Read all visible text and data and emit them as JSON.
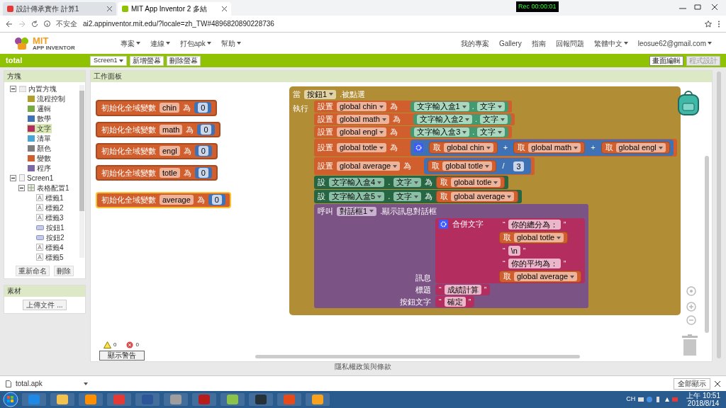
{
  "browser": {
    "tabs": [
      {
        "title": "設計傳承實作 計算1",
        "selected": false
      },
      {
        "title": "MIT App Inventor 2 多結",
        "selected": true
      }
    ],
    "recorder": "Rec 00:00:01",
    "address": {
      "security": "不安全",
      "url": "ai2.appinventor.mit.edu/?locale=zh_TW#4896820890228736"
    }
  },
  "header": {
    "logo_title": "MIT",
    "logo_subtitle": "APP INVENTOR",
    "menus": [
      "專案",
      "連線",
      "打包apk",
      "幫助"
    ],
    "links": [
      "我的專案",
      "Gallery",
      "指南",
      "回報問題"
    ],
    "language": "繁體中文",
    "account": "leosue62@gmail.com"
  },
  "toolbar": {
    "project": "total",
    "screen": "Screen1",
    "buttons": [
      "新增螢幕",
      "刪除螢幕"
    ],
    "modes": [
      {
        "label": "畫面編輯",
        "selected": false
      },
      {
        "label": "程式設計",
        "selected": true
      }
    ]
  },
  "palette": {
    "title": "方塊",
    "tree": [
      {
        "label": "內置方塊",
        "kind": "folder",
        "expanded": true,
        "children": [
          {
            "label": "流程控制",
            "color": "#b1a02c",
            "selected": false
          },
          {
            "label": "邏輯",
            "color": "#77ab41",
            "selected": false
          },
          {
            "label": "數學",
            "color": "#3f71b5",
            "selected": false
          },
          {
            "label": "文字",
            "color": "#b32d5e",
            "selected": true
          },
          {
            "label": "清單",
            "color": "#49a6d4",
            "selected": false
          },
          {
            "label": "顏色",
            "color": "#7d7d7d",
            "selected": false
          },
          {
            "label": "變數",
            "color": "#d05f2d",
            "selected": false
          },
          {
            "label": "程序",
            "color": "#7c68a6",
            "selected": false
          }
        ]
      },
      {
        "label": "Screen1",
        "kind": "screen",
        "expanded": true,
        "children": [
          {
            "label": "表格配置1",
            "kind": "arrangement",
            "expanded": true,
            "children": [
              {
                "label": "標籤1",
                "kind": "label"
              },
              {
                "label": "標籤2",
                "kind": "label"
              },
              {
                "label": "標籤3",
                "kind": "label"
              },
              {
                "label": "按鈕1",
                "kind": "button"
              },
              {
                "label": "按鈕2",
                "kind": "button"
              },
              {
                "label": "標籤4",
                "kind": "label"
              },
              {
                "label": "標籤5",
                "kind": "label"
              }
            ]
          }
        ]
      }
    ],
    "buttons": [
      "重新命名",
      "刪除"
    ]
  },
  "media": {
    "title": "素材",
    "upload": "上傳文件 ..."
  },
  "workspace": {
    "title": "工作面板",
    "globals": [
      {
        "label": "初始化全域變數",
        "name": "chin",
        "to": "為",
        "value": "0",
        "selected": false
      },
      {
        "label": "初始化全域變數",
        "name": "math",
        "to": "為",
        "value": "0",
        "selected": false
      },
      {
        "label": "初始化全域變數",
        "name": "engl",
        "to": "為",
        "value": "0",
        "selected": false
      },
      {
        "label": "初始化全域變數",
        "name": "totle",
        "to": "為",
        "value": "0",
        "selected": false
      },
      {
        "label": "初始化全域變數",
        "name": "average",
        "to": "為",
        "value": "0",
        "selected": true
      }
    ],
    "event": {
      "keyword": "當",
      "component": "按鈕1",
      "event": ".被點選",
      "do_label": "執行",
      "statements": [
        {
          "kind": "set_var",
          "keyword": "設置",
          "var": "global chin",
          "to": "為",
          "value": {
            "kind": "prop",
            "component": "文字輸入盒1",
            "dot": ".",
            "property": "文字"
          }
        },
        {
          "kind": "set_var",
          "keyword": "設置",
          "var": "global math",
          "to": "為",
          "value": {
            "kind": "prop",
            "component": "文字輸入盒2",
            "dot": ".",
            "property": "文字"
          }
        },
        {
          "kind": "set_var",
          "keyword": "設置",
          "var": "global engl",
          "to": "為",
          "value": {
            "kind": "prop",
            "component": "文字輸入盒3",
            "dot": ".",
            "property": "文字"
          }
        },
        {
          "kind": "set_var",
          "keyword": "設置",
          "var": "global totle",
          "to": "為",
          "value": {
            "kind": "math_op",
            "mutator": true,
            "operator": "+",
            "operands": [
              {
                "kind": "get",
                "keyword": "取",
                "var": "global chin"
              },
              {
                "kind": "get",
                "keyword": "取",
                "var": "global math"
              },
              {
                "kind": "get",
                "keyword": "取",
                "var": "global engl"
              }
            ]
          }
        },
        {
          "kind": "set_var",
          "keyword": "設置",
          "var": "global average",
          "to": "為",
          "value": {
            "kind": "math_op",
            "mutator": false,
            "operator": "/",
            "operands": [
              {
                "kind": "get",
                "keyword": "取",
                "var": "global totle"
              },
              {
                "kind": "number",
                "value": "3"
              }
            ]
          }
        },
        {
          "kind": "set_prop",
          "keyword": "設",
          "component": "文字輸入盒4",
          "dot": ".",
          "property": "文字",
          "to": "為",
          "value": {
            "kind": "get",
            "keyword": "取",
            "var": "global totle"
          }
        },
        {
          "kind": "set_prop",
          "keyword": "設",
          "component": "文字輸入盒5",
          "dot": ".",
          "property": "文字",
          "to": "為",
          "value": {
            "kind": "get",
            "keyword": "取",
            "var": "global average"
          }
        },
        {
          "kind": "call",
          "keyword": "呼叫",
          "component": "對話框1",
          "method": ".顯示訊息對話框",
          "args": [
            {
              "label": "訊息",
              "value": {
                "kind": "join",
                "mutator": true,
                "label": "合併文字",
                "items": [
                  {
                    "kind": "text",
                    "open": "“",
                    "value": "你的總分為：",
                    "close": "”"
                  },
                  {
                    "kind": "get",
                    "keyword": "取",
                    "var": "global totle"
                  },
                  {
                    "kind": "text",
                    "open": "“",
                    "value": "\\n",
                    "close": "”"
                  },
                  {
                    "kind": "text",
                    "open": "“",
                    "value": "你的平均為：",
                    "close": "”"
                  },
                  {
                    "kind": "get",
                    "keyword": "取",
                    "var": "global average"
                  }
                ]
              }
            },
            {
              "label": "標題",
              "value": {
                "kind": "text",
                "open": "“",
                "value": "成績計算",
                "close": "”"
              }
            },
            {
              "label": "按鈕文字",
              "value": {
                "kind": "text",
                "open": "“",
                "value": "確定",
                "close": "”"
              }
            }
          ]
        }
      ]
    },
    "warnings": "0",
    "errors": "0",
    "warning_button": "顯示警告"
  },
  "footer": "隱私權政策與條款",
  "download": {
    "file": "total.apk",
    "show_all": "全部顯示"
  },
  "taskbar": {
    "lang": "CH",
    "time": "上午 10:51",
    "date": "2018/8/14"
  }
}
